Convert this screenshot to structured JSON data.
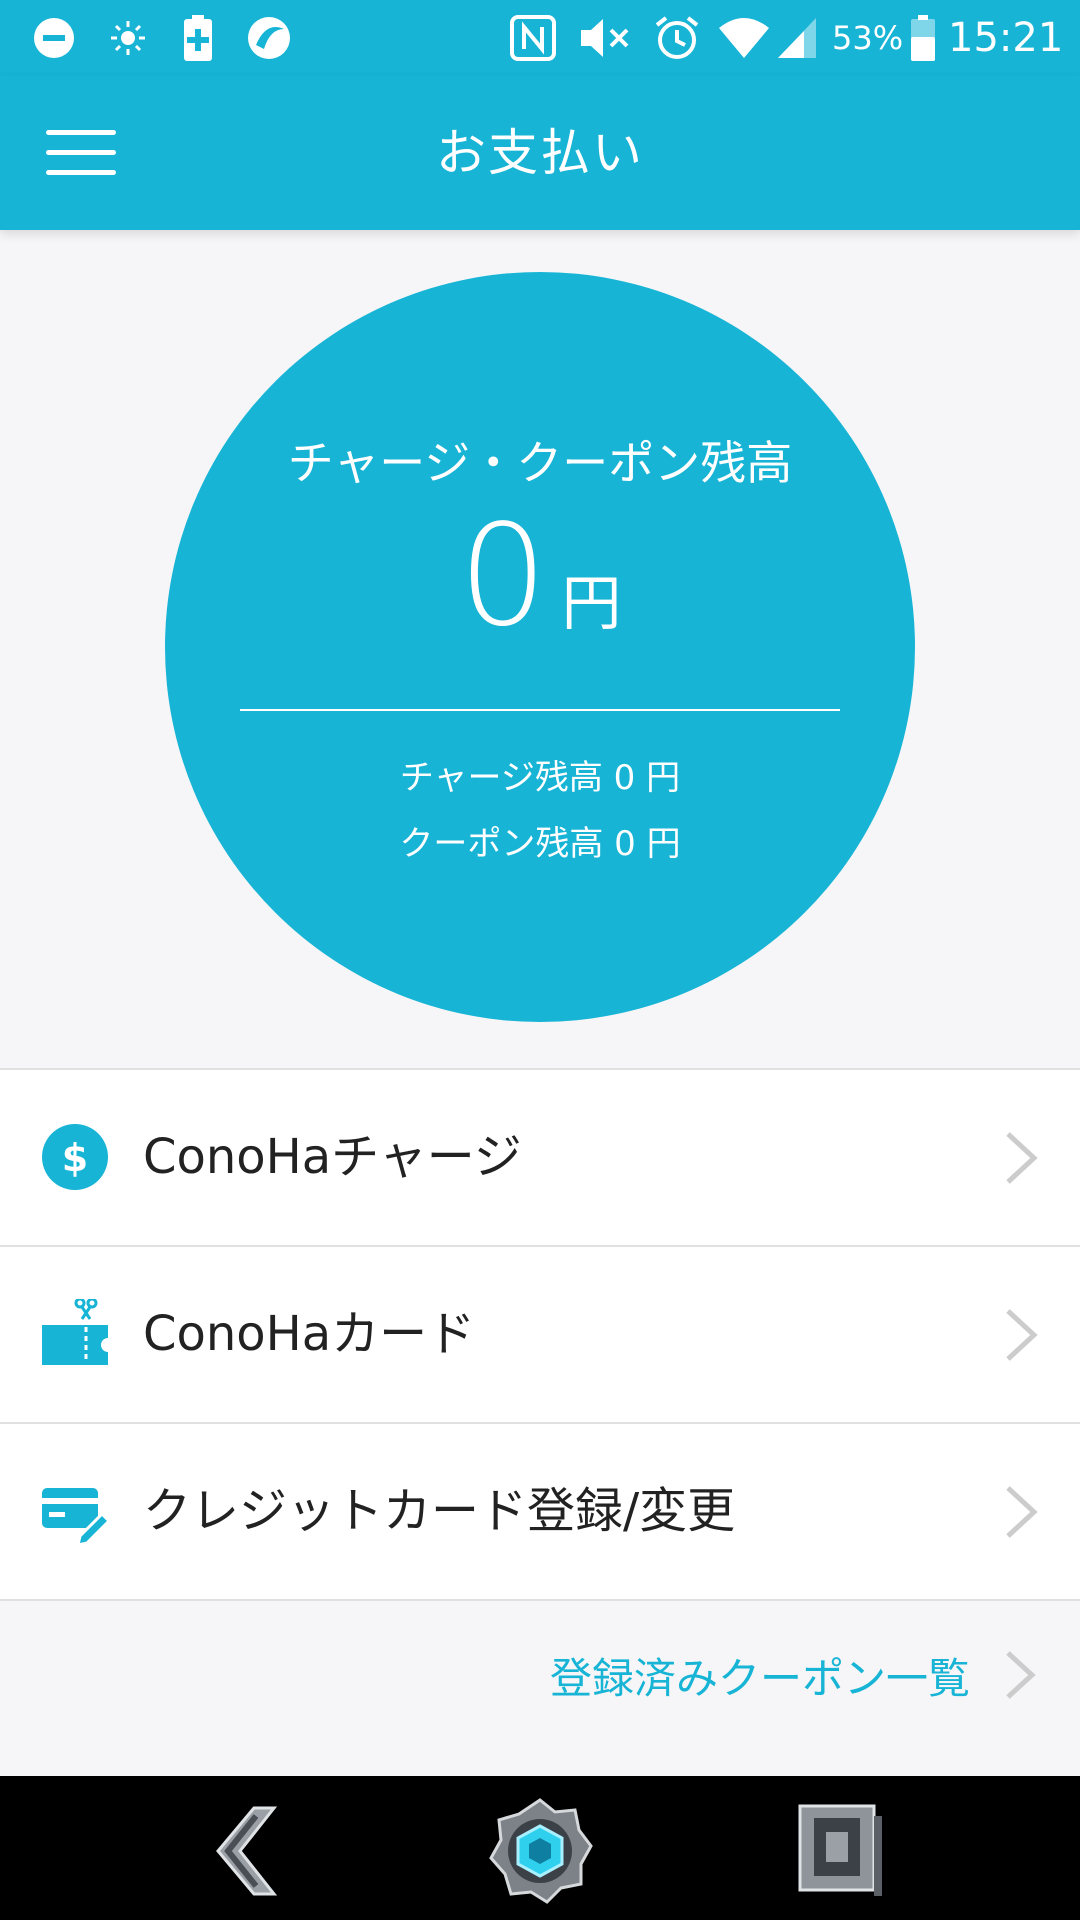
{
  "status_bar": {
    "battery_percent": "53%",
    "time": "15:21",
    "icons": [
      "do-not-disturb-icon",
      "brightness-icon",
      "battery-saver-icon",
      "app-notification-icon",
      "nfc-icon",
      "mute-icon",
      "alarm-icon",
      "wifi-icon",
      "cellular-signal-icon",
      "battery-icon"
    ]
  },
  "header": {
    "title": "お支払い",
    "menu_icon": "hamburger-menu-icon"
  },
  "balance": {
    "title": "チャージ・クーポン残高",
    "amount": "0",
    "currency": "円",
    "charge_line": "チャージ残高 0 円",
    "coupon_line": "クーポン残高 0 円"
  },
  "menu": {
    "items": [
      {
        "label": "ConoHaチャージ",
        "icon": "dollar-coin-icon"
      },
      {
        "label": "ConoHaカード",
        "icon": "ticket-scissors-icon"
      },
      {
        "label": "クレジットカード登録/変更",
        "icon": "credit-card-edit-icon"
      }
    ]
  },
  "coupon_link": {
    "label": "登録済みクーポン一覧"
  },
  "nav_bar": {
    "buttons": [
      "back-icon",
      "home-icon",
      "recent-apps-icon"
    ]
  },
  "colors": {
    "accent": "#17b4d6",
    "background": "#f6f6f8",
    "text": "#222222",
    "divider": "#e0e0e0",
    "chevron": "#cccccc",
    "nav_background": "#000000"
  }
}
